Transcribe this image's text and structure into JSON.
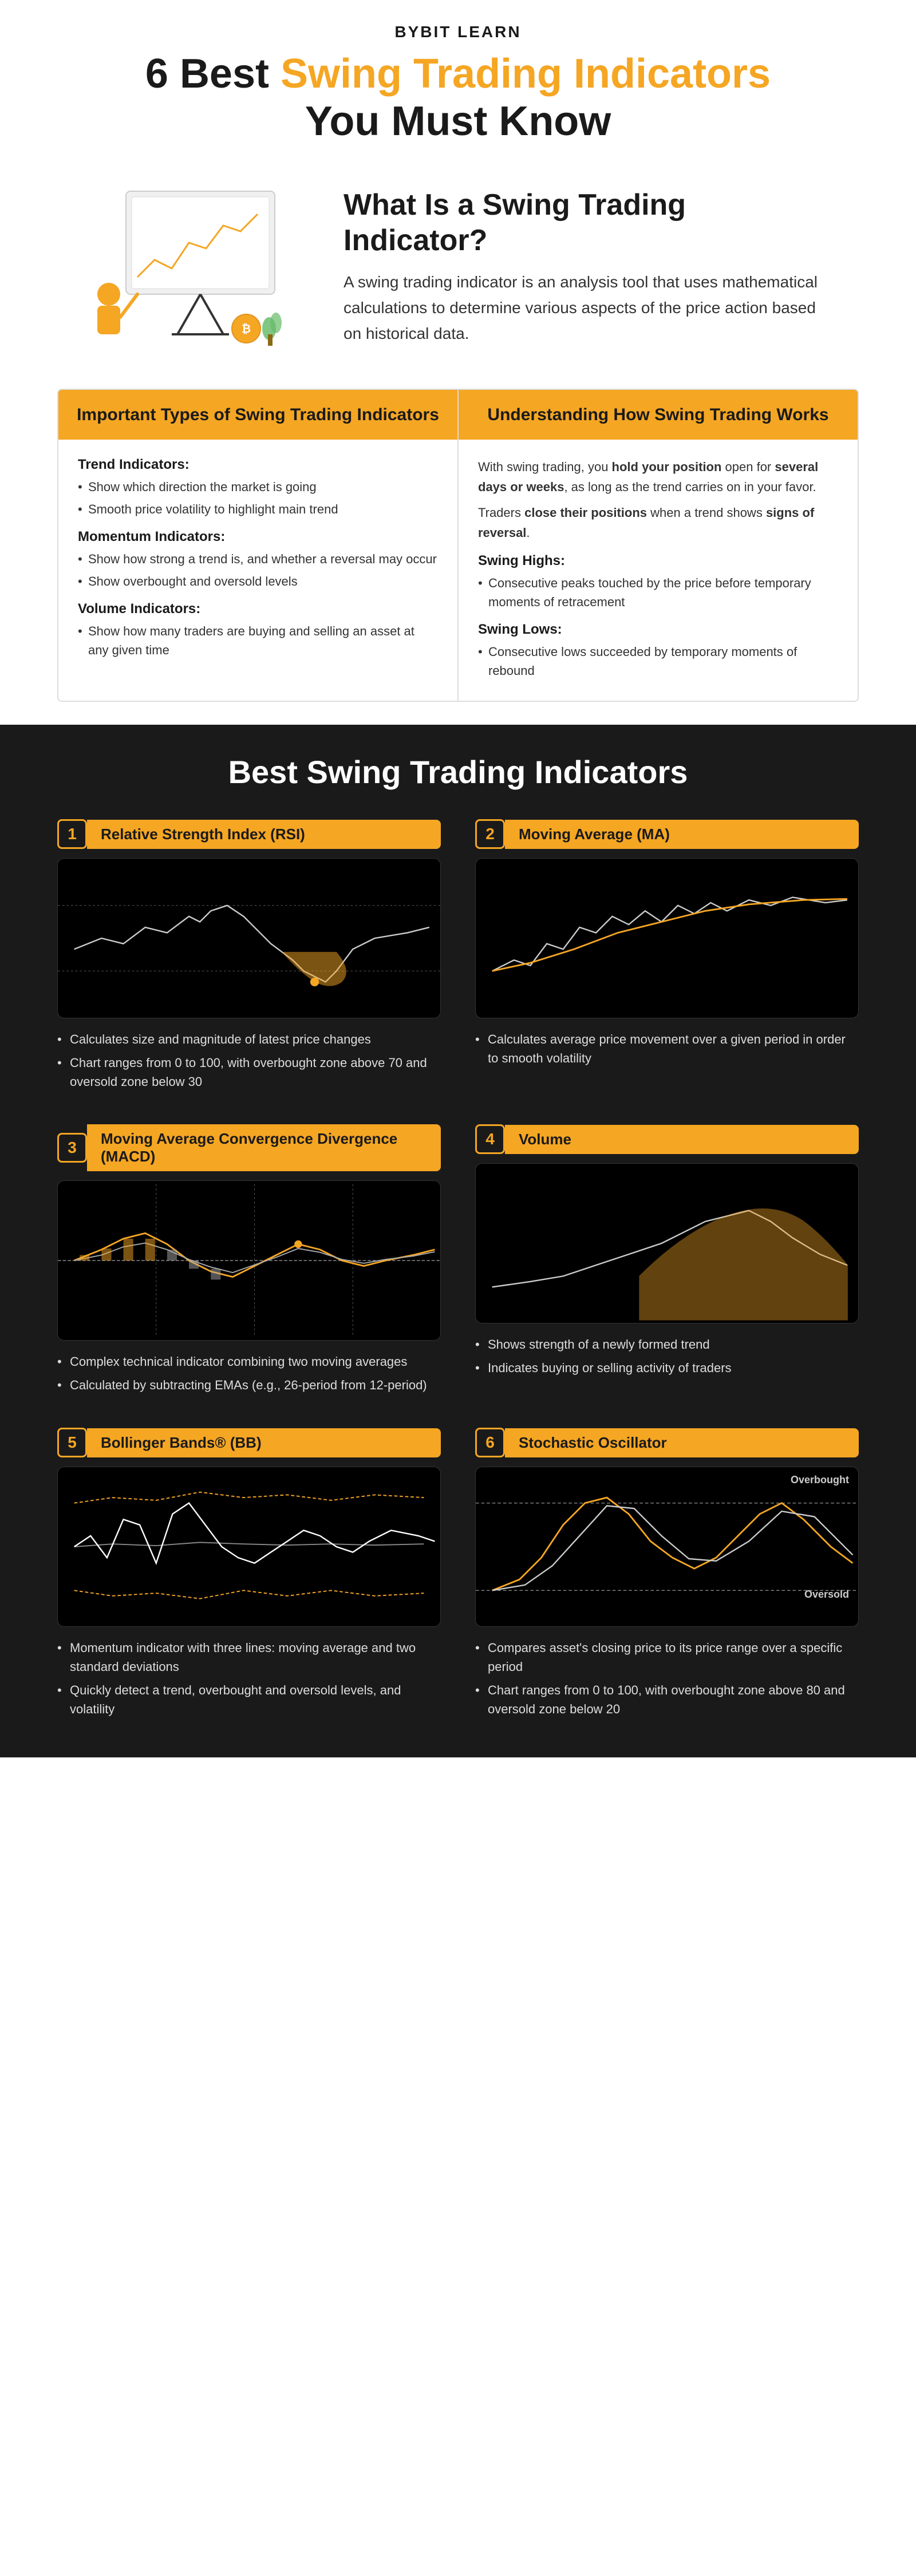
{
  "brand": {
    "name": "BYBIT LEARN"
  },
  "header": {
    "title_part1": "6 Best ",
    "title_orange": "Swing Trading Indicators",
    "title_part2": " You Must Know"
  },
  "intro": {
    "heading": "What Is a Swing Trading Indicator?",
    "body": "A swing trading indicator is an analysis tool that uses mathematical calculations to determine various aspects of the price action based on historical data."
  },
  "info_cols": [
    {
      "header": "Important Types of Swing Trading Indicators",
      "items": [
        {
          "title": "Trend Indicators:",
          "bullets": [
            "Show which direction the market is going",
            "Smooth price volatility to highlight main trend"
          ]
        },
        {
          "title": "Momentum Indicators:",
          "bullets": [
            "Show how strong a trend is, and whether a reversal may occur",
            "Show overbought and oversold levels"
          ]
        },
        {
          "title": "Volume Indicators:",
          "bullets": [
            "Show how many traders are buying and selling an asset at any given time"
          ]
        }
      ]
    },
    {
      "header": "Understanding How Swing Trading Works",
      "paras": [
        "With swing trading, you <b>hold your position</b> open for <b>several days or weeks</b>, as long as the trend carries on in your favor.",
        "Traders <b>close their positions</b> when a trend shows <b>signs of reversal</b>."
      ],
      "sub_items": [
        {
          "title": "Swing Highs:",
          "bullets": [
            "Consecutive peaks touched by the price before temporary moments of retracement"
          ]
        },
        {
          "title": "Swing Lows:",
          "bullets": [
            "Consecutive lows succeeded by temporary moments of rebound"
          ]
        }
      ]
    }
  ],
  "indicators_section_title": "Best Swing Trading Indicators",
  "indicators": [
    {
      "number": "1",
      "label": "Relative Strength Index (RSI)",
      "bullets": [
        "Calculates size and magnitude of latest price changes",
        "Chart ranges from 0 to 100, with overbought zone above 70 and oversold zone below 30"
      ]
    },
    {
      "number": "2",
      "label": "Moving Average (MA)",
      "bullets": [
        "Calculates average price movement over a given period in order to smooth volatility"
      ]
    },
    {
      "number": "3",
      "label": "Moving Average Convergence Divergence (MACD)",
      "bullets": [
        "Complex technical indicator combining two moving averages",
        "Calculated by subtracting EMAs (e.g., 26-period from 12-period)"
      ]
    },
    {
      "number": "4",
      "label": "Volume",
      "bullets": [
        "Shows strength of a newly formed trend",
        "Indicates buying or selling activity of traders"
      ]
    },
    {
      "number": "5",
      "label": "Bollinger Bands® (BB)",
      "bullets": [
        "Momentum indicator with three lines: moving average and two standard deviations",
        "Quickly detect a trend, overbought and oversold levels, and volatility"
      ]
    },
    {
      "number": "6",
      "label": "Stochastic Oscillator",
      "bullets": [
        "Compares asset's closing price to its price range over a specific period",
        "Chart ranges from 0 to 100, with overbought zone above 80 and oversold zone below 20"
      ]
    }
  ]
}
